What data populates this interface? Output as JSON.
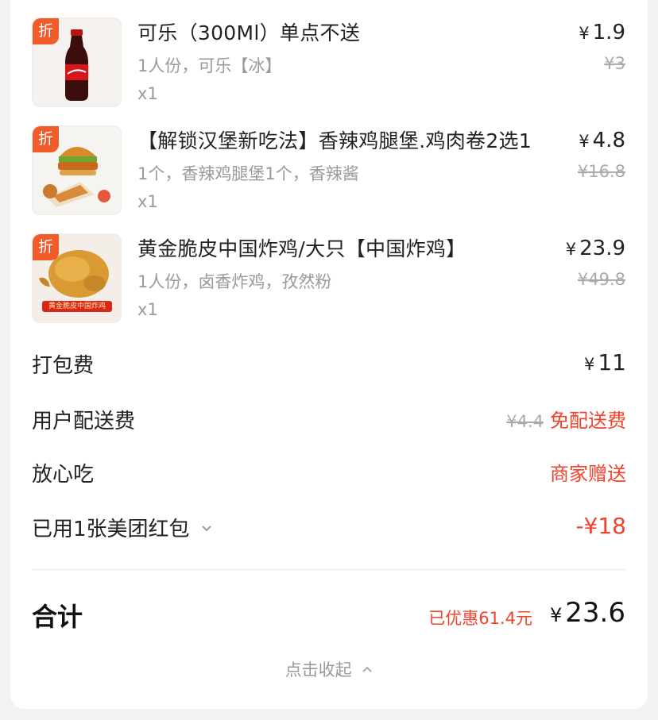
{
  "items": [
    {
      "badge": "折",
      "name": "可乐（300Ml）单点不送",
      "spec": "1人份，可乐【冰】",
      "qty": "x1",
      "currency": "¥",
      "price": "1.9",
      "original_price": "¥3",
      "image_icon": "cola-bottle-icon"
    },
    {
      "badge": "折",
      "name": "【解锁汉堡新吃法】香辣鸡腿堡.鸡肉卷2选1",
      "spec": "1个，香辣鸡腿堡1个，香辣酱",
      "qty": "x1",
      "currency": "¥",
      "price": "4.8",
      "original_price": "¥16.8",
      "image_icon": "burger-wrap-icon"
    },
    {
      "badge": "折",
      "name": "黄金脆皮中国炸鸡/大只【中国炸鸡】",
      "spec": "1人份，卤香炸鸡，孜然粉",
      "qty": "x1",
      "currency": "¥",
      "price": "23.9",
      "original_price": "¥49.8",
      "image_caption": "黄金脆皮中国炸鸡",
      "image_icon": "fried-chicken-icon"
    }
  ],
  "fees": {
    "packing": {
      "label": "打包费",
      "currency": "¥",
      "value": "11"
    },
    "delivery": {
      "label": "用户配送费",
      "original": "¥4.4",
      "value": "免配送费"
    },
    "assurance": {
      "label": "放心吃",
      "value": "商家赠送"
    },
    "coupon": {
      "label": "已用1张美团红包",
      "value": "-¥18"
    }
  },
  "total": {
    "label": "合计",
    "saved": "已优惠61.4元",
    "currency": "¥",
    "value": "23.6"
  },
  "collapse_label": "点击收起",
  "colors": {
    "accent_red": "#f2422c",
    "badge_orange": "#f25c2b",
    "muted_text": "#9a9a9a"
  }
}
